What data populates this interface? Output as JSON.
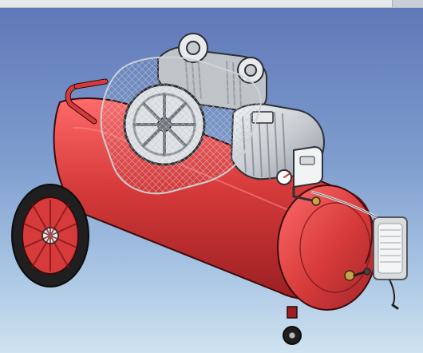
{
  "window": {
    "title": ""
  },
  "viewport": {
    "background_gradient": [
      "#5f78b8",
      "#cfe2f0"
    ],
    "model": {
      "subject": "air-compressor-assembly",
      "parts": [
        "tank",
        "pump-head",
        "flywheel-with-guard",
        "electric-motor",
        "pressure-switch",
        "pressure-gauge",
        "handle",
        "wheel",
        "caster-wheel",
        "drain-valve",
        "air-hose-reel"
      ],
      "colors": {
        "tank_red": "#d63a3a",
        "tank_shadow": "#9b1f22",
        "wheel_black": "#1f1f1f",
        "metal_gray": "#b7bcc2",
        "mesh_gray": "#c3c7cc"
      }
    }
  }
}
